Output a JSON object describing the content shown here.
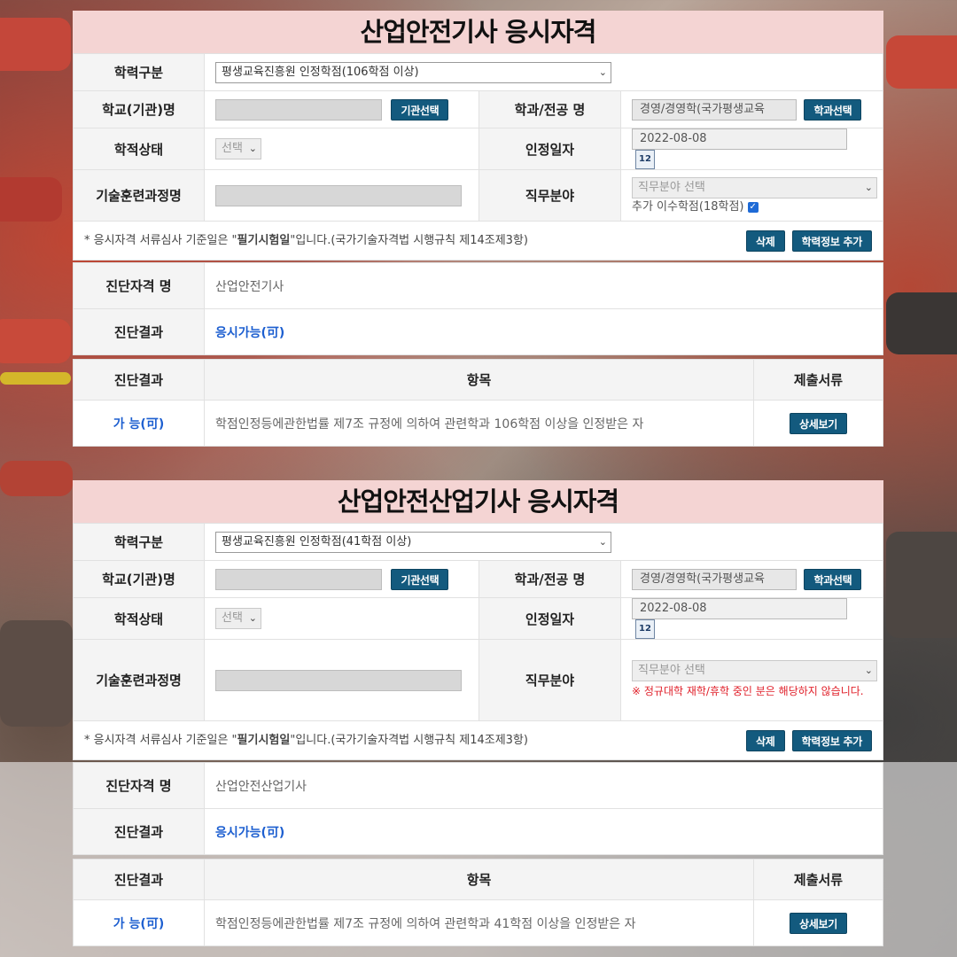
{
  "colors": {
    "title_bg": "#f4d4d3",
    "button": "#135a7e",
    "result_blue": "#1d5fd0",
    "warning_red": "#e0202a"
  },
  "panels": [
    {
      "title": "산업안전기사 응시자격",
      "edu_label": "학력구분",
      "edu_value": "평생교육진흥원 인정학점(106학점 이상)",
      "school_label": "학교(기관)명",
      "school_btn": "기관선택",
      "major_label": "학과/전공 명",
      "major_value": "경영/경영학(국가평생교육",
      "major_btn": "학과선택",
      "status_label": "학적상태",
      "status_value": "선택",
      "date_label": "인정일자",
      "date_value": "2022-08-08",
      "cal_icon": "12",
      "course_label": "기술훈련과정명",
      "job_label": "직무분야",
      "job_value": "직무분야 선택",
      "extra_text": "추가 이수학점(18학점)",
      "warning": "",
      "note_pre": "* 응시자격 서류심사 기준일은 \"",
      "note_bold": "필기시험일",
      "note_post": "\"입니다.(국가기술자격법 시행규칙 제14조제3항)",
      "delete_btn": "삭제",
      "add_btn": "학력정보 추가",
      "diag_name_label": "진단자격 명",
      "diag_name": "산업안전기사",
      "diag_result_label": "진단결과",
      "diag_result": "응시가능(可)",
      "th_result": "진단결과",
      "th_item": "항목",
      "th_docs": "제출서류",
      "row_result": "가 능(可)",
      "row_item": "학점인정등에관한법률 제7조 규정에 의하여 관련학과 106학점 이상을 인정받은 자",
      "detail_btn": "상세보기"
    },
    {
      "title": "산업안전산업기사 응시자격",
      "edu_label": "학력구분",
      "edu_value": "평생교육진흥원 인정학점(41학점 이상)",
      "school_label": "학교(기관)명",
      "school_btn": "기관선택",
      "major_label": "학과/전공 명",
      "major_value": "경영/경영학(국가평생교육",
      "major_btn": "학과선택",
      "status_label": "학적상태",
      "status_value": "선택",
      "date_label": "인정일자",
      "date_value": "2022-08-08",
      "cal_icon": "12",
      "course_label": "기술훈련과정명",
      "job_label": "직무분야",
      "job_value": "직무분야 선택",
      "extra_text": "",
      "warning": "※ 정규대학 재학/휴학 중인 분은 해당하지 않습니다.",
      "note_pre": "* 응시자격 서류심사 기준일은 \"",
      "note_bold": "필기시험일",
      "note_post": "\"입니다.(국가기술자격법 시행규칙 제14조제3항)",
      "delete_btn": "삭제",
      "add_btn": "학력정보 추가",
      "diag_name_label": "진단자격 명",
      "diag_name": "산업안전산업기사",
      "diag_result_label": "진단결과",
      "diag_result": "응시가능(可)",
      "th_result": "진단결과",
      "th_item": "항목",
      "th_docs": "제출서류",
      "row_result": "가 능(可)",
      "row_item": "학점인정등에관한법률 제7조 규정에 의하여 관련학과 41학점 이상을 인정받은 자",
      "detail_btn": "상세보기"
    }
  ]
}
